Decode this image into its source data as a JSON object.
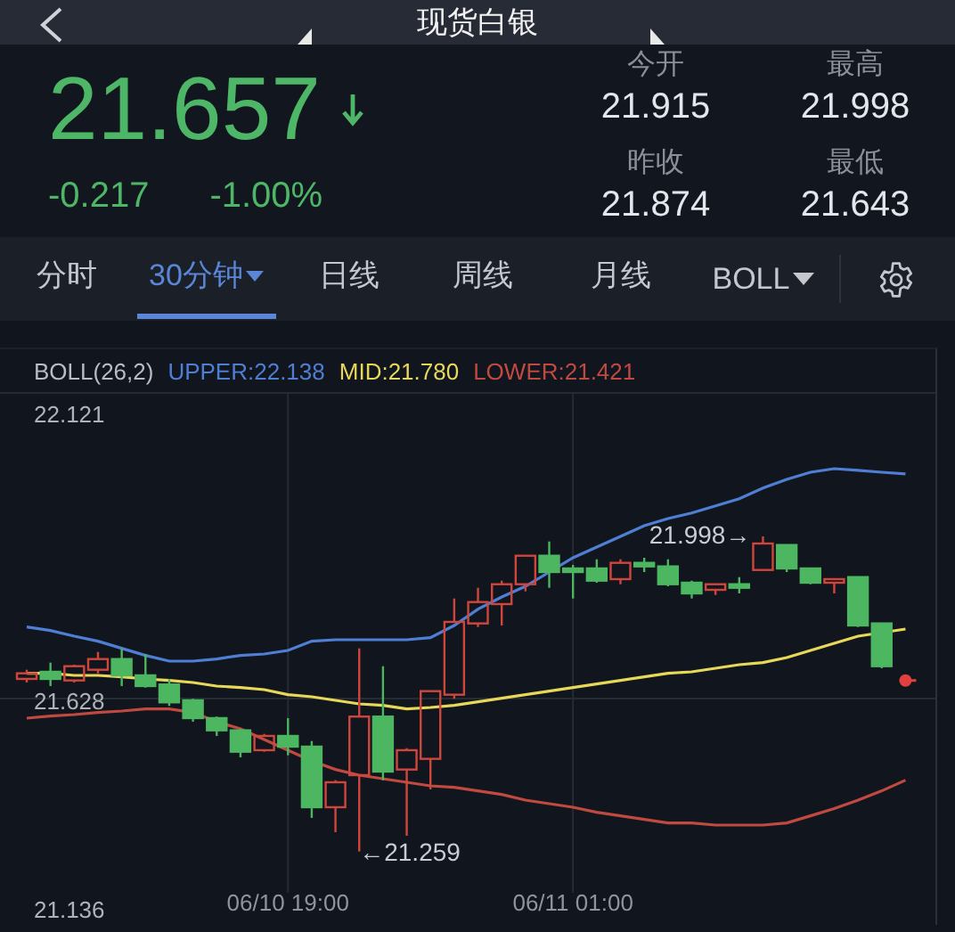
{
  "header": {
    "title": "现货白银"
  },
  "quote": {
    "price": "21.657",
    "change": "-0.217",
    "change_pct": "-1.00%"
  },
  "stats": [
    {
      "label": "今开",
      "value": "21.915"
    },
    {
      "label": "最高",
      "value": "21.998"
    },
    {
      "label": "昨收",
      "value": "21.874"
    },
    {
      "label": "最低",
      "value": "21.643"
    }
  ],
  "tabs": [
    {
      "label": "分时",
      "selected": false,
      "dropdown": false
    },
    {
      "label": "30分钟",
      "selected": true,
      "dropdown": true
    },
    {
      "label": "日线",
      "selected": false,
      "dropdown": false
    },
    {
      "label": "周线",
      "selected": false,
      "dropdown": false
    },
    {
      "label": "月线",
      "selected": false,
      "dropdown": false
    }
  ],
  "indicator_menu": {
    "label": "BOLL"
  },
  "legend": {
    "title": "BOLL(26,2)",
    "items": [
      {
        "text": "UPPER:22.138",
        "color": "#4f7fd4"
      },
      {
        "text": "MID:21.780",
        "color": "#e8d85a"
      },
      {
        "text": "LOWER:21.421",
        "color": "#c04a40"
      }
    ]
  },
  "chart": {
    "y_labels": [
      "22.121",
      "21.628",
      "21.136"
    ],
    "x_labels": [
      "06/10 19:00",
      "06/11 01:00"
    ],
    "high_label": "21.998→",
    "low_label": "←21.259"
  }
}
